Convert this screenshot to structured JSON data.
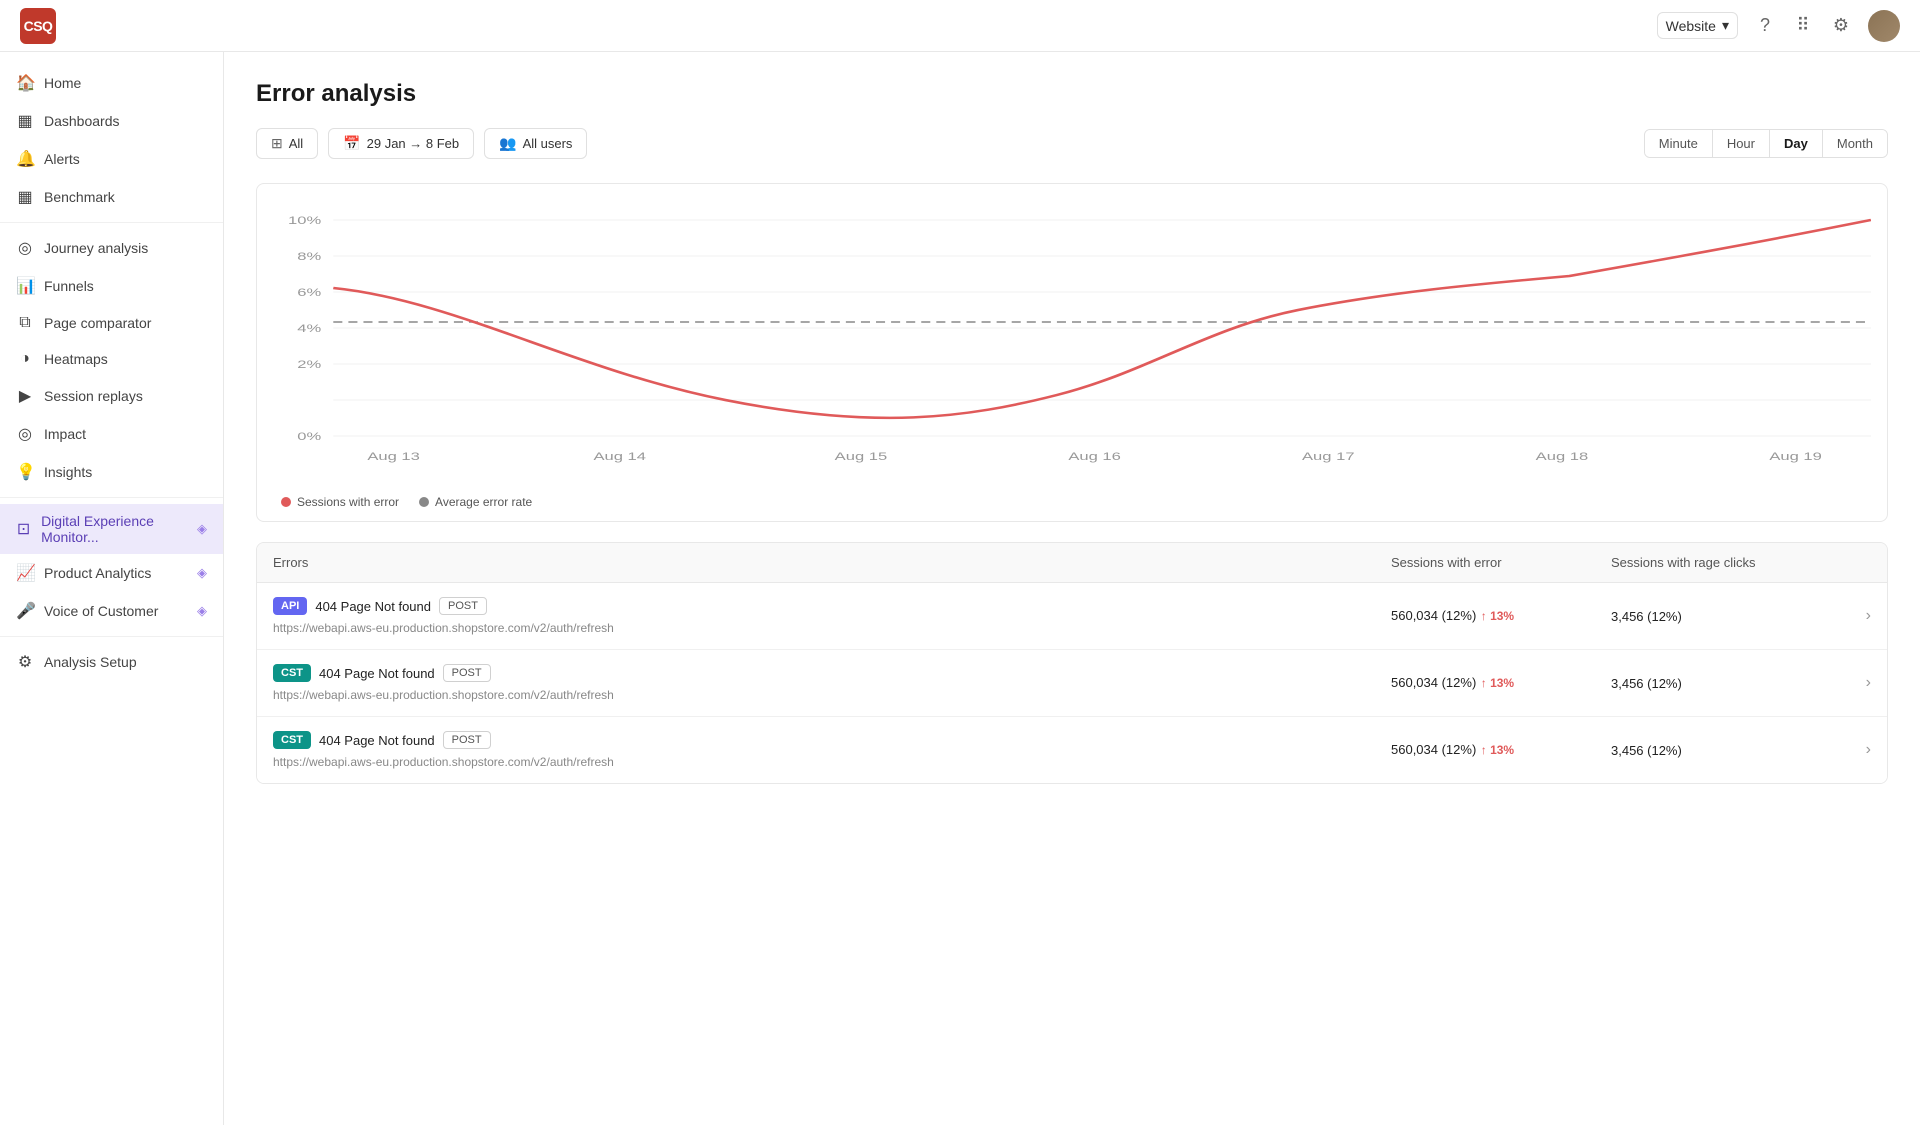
{
  "topbar": {
    "logo": "CSQ",
    "website": "Website",
    "icons": [
      "help-circle",
      "grid",
      "settings",
      "user-avatar"
    ]
  },
  "sidebar": {
    "items": [
      {
        "id": "home",
        "label": "Home",
        "icon": "🏠",
        "active": false
      },
      {
        "id": "dashboards",
        "label": "Dashboards",
        "icon": "⊞",
        "active": false
      },
      {
        "id": "alerts",
        "label": "Alerts",
        "icon": "🔔",
        "active": false
      },
      {
        "id": "benchmark",
        "label": "Benchmark",
        "icon": "▦",
        "active": false
      },
      {
        "id": "journey-analysis",
        "label": "Journey analysis",
        "icon": "◎",
        "active": false
      },
      {
        "id": "funnels",
        "label": "Funnels",
        "icon": "📊",
        "active": false
      },
      {
        "id": "page-comparator",
        "label": "Page comparator",
        "icon": "⧉",
        "active": false
      },
      {
        "id": "heatmaps",
        "label": "Heatmaps",
        "icon": "◑",
        "active": false
      },
      {
        "id": "session-replays",
        "label": "Session replays",
        "icon": "▶",
        "active": false
      },
      {
        "id": "impact",
        "label": "Impact",
        "icon": "◎",
        "active": false
      },
      {
        "id": "insights",
        "label": "Insights",
        "icon": "💡",
        "active": false
      },
      {
        "id": "digital-experience",
        "label": "Digital Experience Monitor...",
        "icon": "⊡",
        "active": true,
        "diamond": true
      },
      {
        "id": "product-analytics",
        "label": "Product Analytics",
        "icon": "📈",
        "active": false,
        "diamond": true
      },
      {
        "id": "voice-of-customer",
        "label": "Voice of Customer",
        "icon": "🎤",
        "active": false,
        "diamond": true
      },
      {
        "id": "analysis-setup",
        "label": "Analysis Setup",
        "icon": "⚙",
        "active": false
      }
    ]
  },
  "page": {
    "title": "Error analysis",
    "filters": {
      "all_label": "All",
      "date_range": "29 Jan → 8 Feb",
      "users_label": "All users"
    },
    "time_controls": [
      "Minute",
      "Hour",
      "Day",
      "Month"
    ],
    "active_time_control": "Day"
  },
  "chart": {
    "y_labels": [
      "10%",
      "8%",
      "6%",
      "4%",
      "2%",
      "0%"
    ],
    "x_labels": [
      "Aug 13",
      "Aug 14",
      "Aug 15",
      "Aug 16",
      "Aug 17",
      "Aug 18",
      "Aug 19"
    ],
    "legend": {
      "sessions_with_error": "Sessions with error",
      "average_error_rate": "Average error rate"
    }
  },
  "table": {
    "columns": [
      "Errors",
      "Sessions with error",
      "Sessions with rage clicks"
    ],
    "rows": [
      {
        "badge_type": "API",
        "badge_style": "api",
        "error_title": "404 Page Not found",
        "method": "POST",
        "url": "https://webapi.aws-eu.production.shopstore.com/v2/auth/refresh",
        "sessions": "560,034 (12%)",
        "trend": "↑ 13%",
        "rage_clicks": "3,456 (12%)"
      },
      {
        "badge_type": "CST",
        "badge_style": "cst",
        "error_title": "404 Page Not found",
        "method": "POST",
        "url": "https://webapi.aws-eu.production.shopstore.com/v2/auth/refresh",
        "sessions": "560,034 (12%)",
        "trend": "↑ 13%",
        "rage_clicks": "3,456 (12%)"
      },
      {
        "badge_type": "CST",
        "badge_style": "cst",
        "error_title": "404 Page Not found",
        "method": "POST",
        "url": "https://webapi.aws-eu.production.shopstore.com/v2/auth/refresh",
        "sessions": "560,034 (12%)",
        "trend": "↑ 13%",
        "rage_clicks": "3,456 (12%)"
      }
    ]
  }
}
